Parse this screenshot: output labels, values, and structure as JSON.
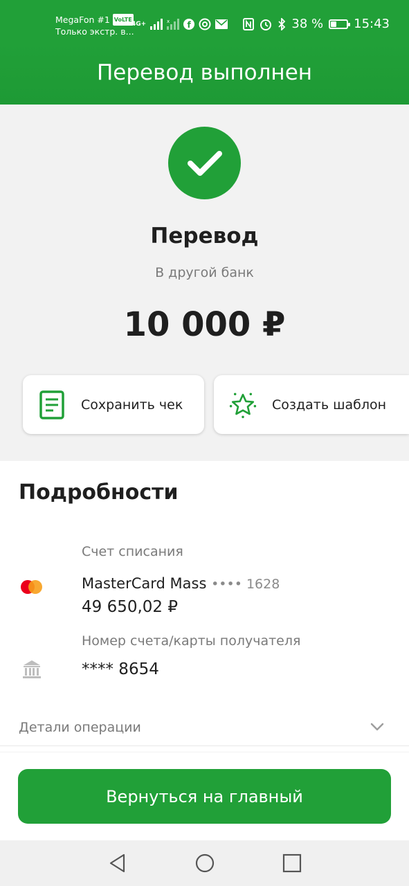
{
  "statusbar": {
    "carrier": "MegaFon #1",
    "volte": "VoLTE",
    "carrier_sub": "Только экстр. в...",
    "network": "4G+",
    "battery_percent": "38 %",
    "battery_level": 0.38,
    "time": "15:43"
  },
  "header": {
    "title": "Перевод выполнен"
  },
  "summary": {
    "title": "Перевод",
    "subtitle": "В другой банк",
    "amount": "10 000 ₽"
  },
  "actions": {
    "save_receipt": "Сохранить чек",
    "create_template": "Создать шаблон"
  },
  "details": {
    "title": "Подробности",
    "debit_label": "Счет списания",
    "card_name": "MasterCard Mass",
    "card_mask": "•••• 1628",
    "card_balance": "49 650,02 ₽",
    "recipient_label": "Номер счета/карты получателя",
    "recipient_value": "**** 8654",
    "operation_details": "Детали операции"
  },
  "footer": {
    "back_button": "Вернуться на главный"
  },
  "colors": {
    "accent": "#21a038",
    "mc_red": "#eb001b",
    "mc_orange": "#f79e1b"
  }
}
